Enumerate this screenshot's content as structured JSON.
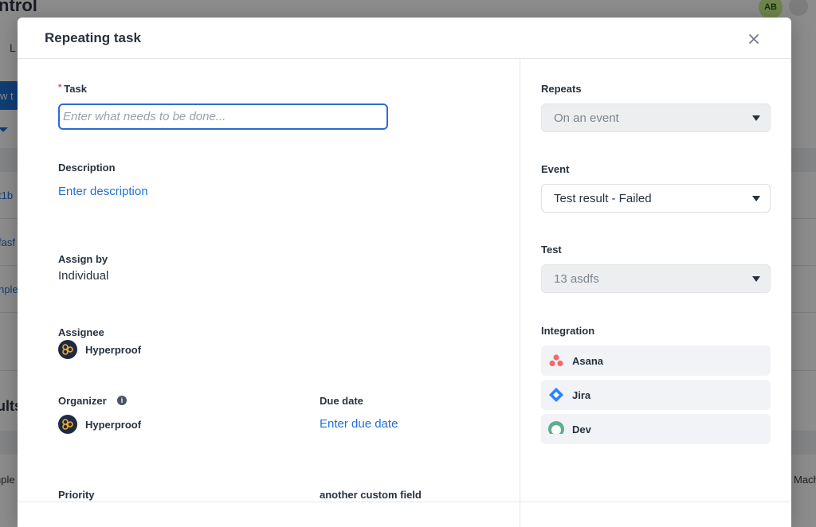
{
  "background": {
    "page_title": "ntrol",
    "avatar_initials": "AB",
    "tab_label": "L",
    "button_label": "w t",
    "heading": "ults",
    "rows": [
      "t1b",
      "fasf",
      "nple",
      "nple",
      "Mach"
    ]
  },
  "modal": {
    "title": "Repeating task",
    "task": {
      "label": "Task",
      "required_mark": "*",
      "placeholder": "Enter what needs to be done..."
    },
    "description": {
      "label": "Description",
      "link": "Enter description"
    },
    "assign_by": {
      "label": "Assign by",
      "value": "Individual"
    },
    "assignee": {
      "label": "Assignee",
      "name": "Hyperproof"
    },
    "organizer": {
      "label": "Organizer",
      "name": "Hyperproof",
      "info_icon": "i"
    },
    "due_date": {
      "label": "Due date",
      "link": "Enter due date"
    },
    "priority": {
      "label": "Priority"
    },
    "custom_field": {
      "label": "another custom field"
    },
    "repeats": {
      "label": "Repeats",
      "value": "On an event"
    },
    "event": {
      "label": "Event",
      "value": "Test result - Failed"
    },
    "test": {
      "label": "Test",
      "value": "13 asdfs"
    },
    "integration": {
      "label": "Integration",
      "items": [
        {
          "name": "Asana",
          "icon": "asana-icon",
          "color": "#f06a6a"
        },
        {
          "name": "Jira",
          "icon": "jira-icon",
          "color": "#2684ff"
        },
        {
          "name": "Dev",
          "icon": "dev-icon",
          "color": "#5fae8e"
        }
      ]
    }
  },
  "colors": {
    "accent": "#1f6fd6",
    "required": "#e5484d",
    "avatar_bg": "#1d2a44",
    "avatar_fg": "#f5a623"
  }
}
